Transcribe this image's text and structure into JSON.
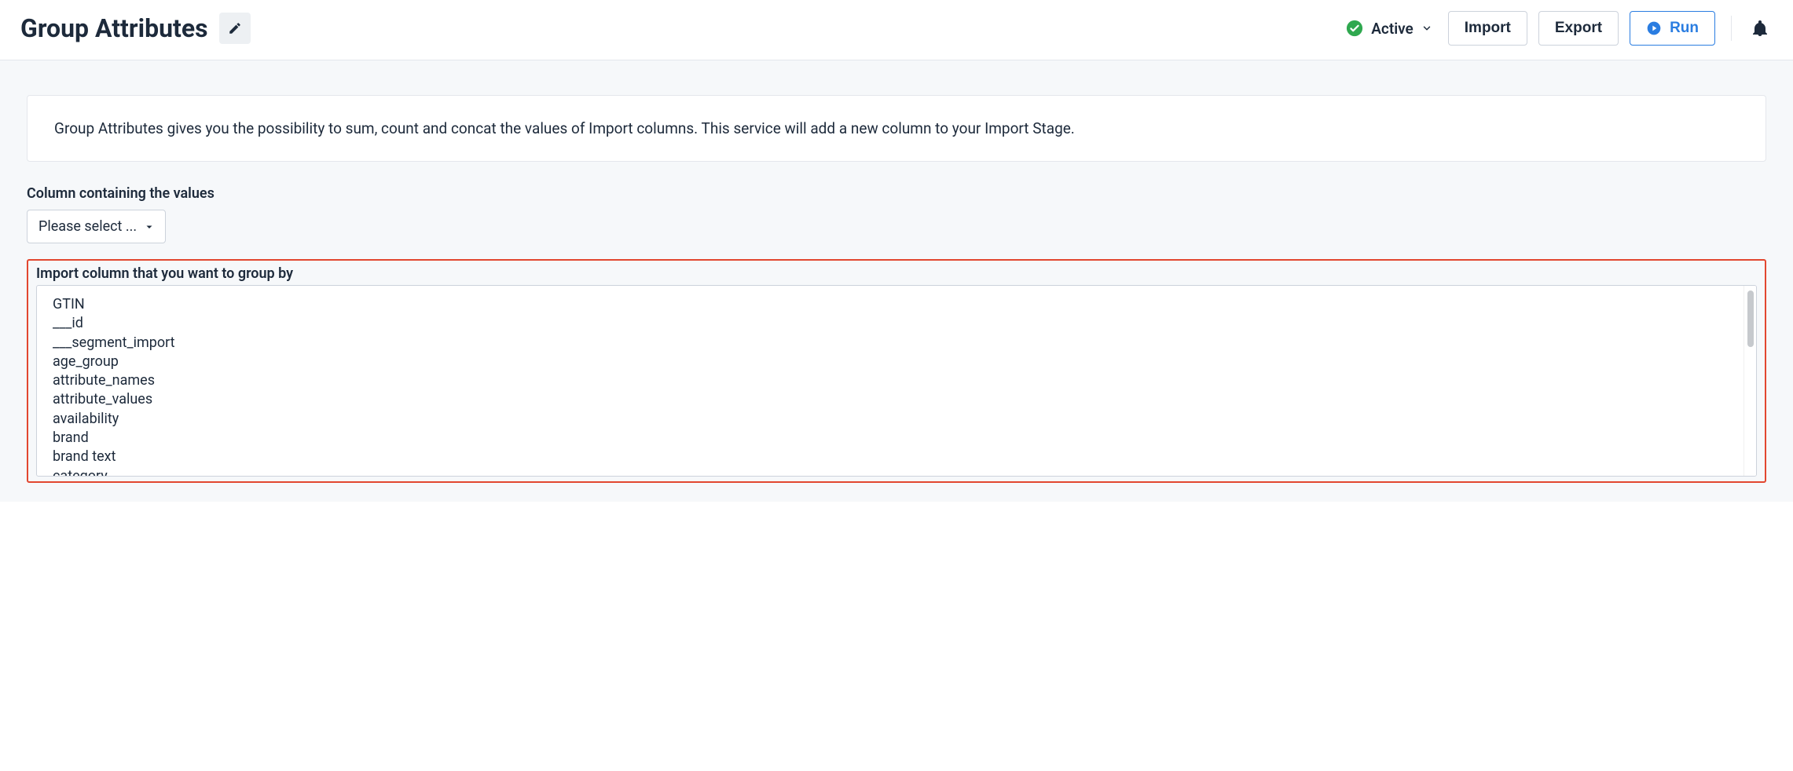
{
  "header": {
    "title": "Group Attributes",
    "status_label": "Active",
    "import_label": "Import",
    "export_label": "Export",
    "run_label": "Run"
  },
  "info_text": "Group Attributes gives you the possibility to sum, count and concat the values of Import columns. This service will add a new column to your Import Stage.",
  "column_field": {
    "label": "Column containing the values",
    "placeholder": "Please select ..."
  },
  "group_by": {
    "label": "Import column that you want to group by",
    "options": [
      "GTIN",
      "___id",
      "___segment_import",
      "age_group",
      "attribute_names",
      "attribute_values",
      "availability",
      "brand",
      "brand text",
      "category"
    ]
  }
}
